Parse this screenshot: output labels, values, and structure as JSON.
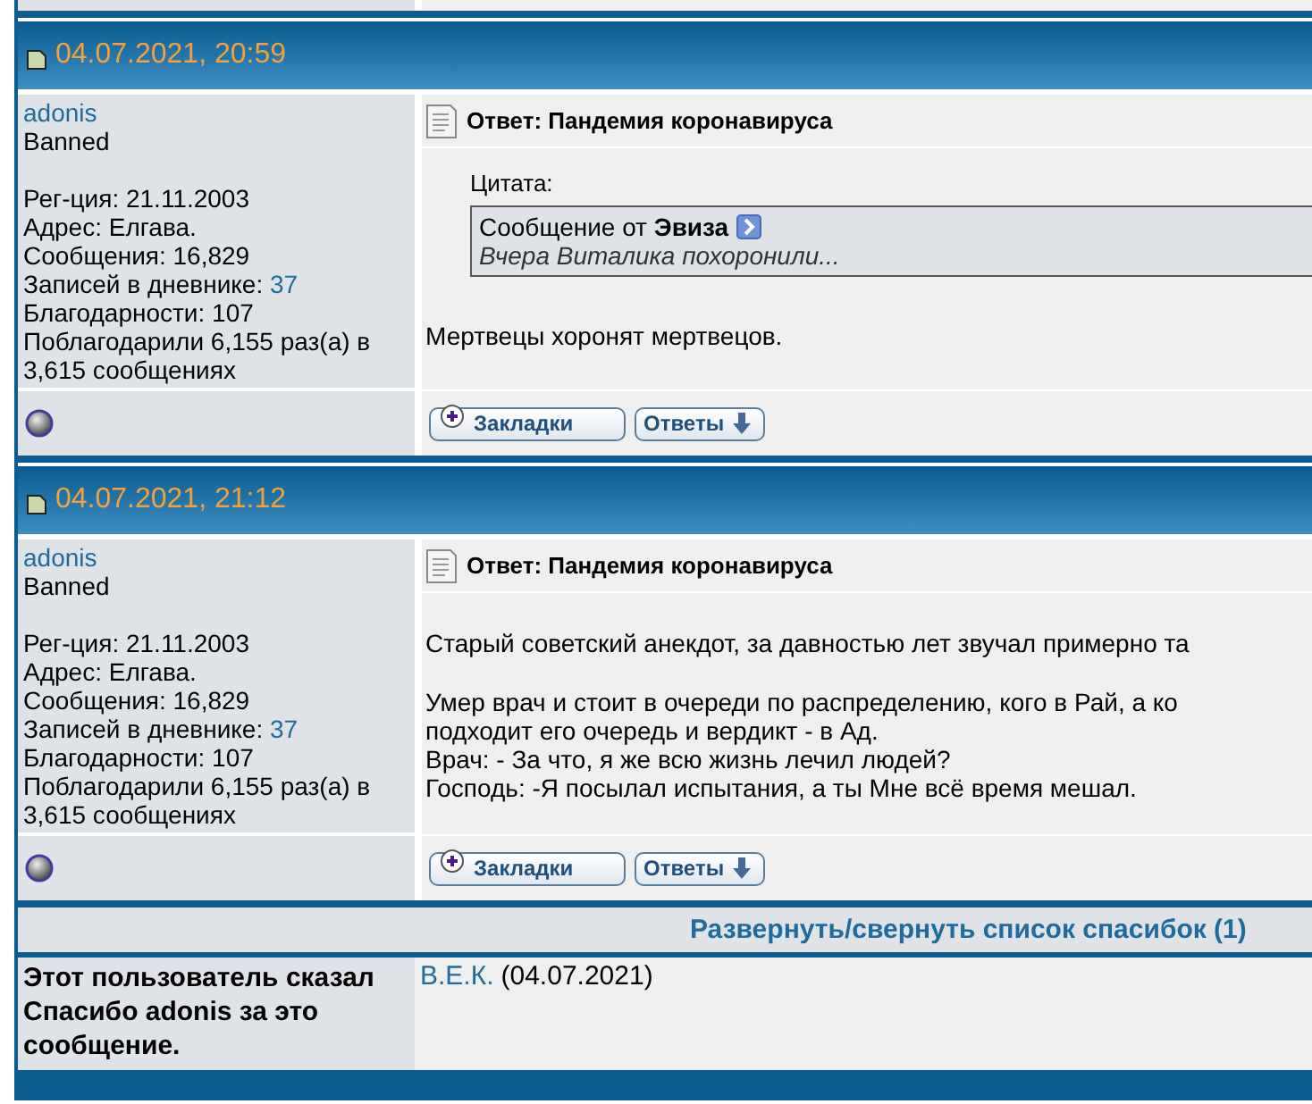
{
  "posts": [
    {
      "date": "04.07.2021, 20:59",
      "user": {
        "name": "adonis",
        "title": "Banned",
        "stats": [
          {
            "text": "Рег-ция: 21.11.2003"
          },
          {
            "text": "Адрес: Елгава."
          },
          {
            "text": "Сообщения: 16,829"
          },
          {
            "text": "Записей в дневнике:",
            "link": "37"
          },
          {
            "text": "Благодарности: 107"
          },
          {
            "text": "Поблагодарили 6,155 раз(а) в 3,615 сообщениях"
          }
        ]
      },
      "title": "Ответ: Пандемия коронавируса",
      "quote": {
        "label": "Цитата:",
        "header": "Сообщение от **Эвиза**",
        "text": "Вчера Виталика похоронили..."
      },
      "paragraphs": [
        [
          "Мертвецы хоронят мертвецов."
        ]
      ],
      "buttons": [
        {
          "kind": "bookmark",
          "label": "Закладки"
        },
        {
          "kind": "replies",
          "label": "Ответы"
        }
      ]
    },
    {
      "date": "04.07.2021, 21:12",
      "user": {
        "name": "adonis",
        "title": "Banned",
        "stats": [
          {
            "text": "Рег-ция: 21.11.2003"
          },
          {
            "text": "Адрес: Елгава."
          },
          {
            "text": "Сообщения: 16,829"
          },
          {
            "text": "Записей в дневнике:",
            "link": "37"
          },
          {
            "text": "Благодарности: 107"
          },
          {
            "text": "Поблагодарили 6,155 раз(а) в 3,615 сообщениях"
          }
        ]
      },
      "title": "Ответ: Пандемия коронавируса",
      "paragraphs": [
        [
          "Старый советский анекдот, за давностью лет звучал примерно та"
        ],
        [
          "Умер врач и стоит в очереди по распределению, кого в Рай, а ко",
          "подходит его очередь и вердикт - в Ад.",
          "Врач: - За что, я же всю жизнь лечил людей?",
          "Господь: -Я посылал испытания, а ты Мне всё время мешал."
        ]
      ],
      "buttons": [
        {
          "kind": "bookmark",
          "label": "Закладки"
        },
        {
          "kind": "replies",
          "label": "Ответы"
        }
      ]
    }
  ],
  "thanks": {
    "toggle": "Развернуть/свернуть список спасибок (1)",
    "label": "Этот пользователь сказал Спасибо adonis за это сообщение.",
    "users": [
      {
        "name": "В.Е.К.",
        "date": "(04.07.2021)"
      }
    ]
  }
}
